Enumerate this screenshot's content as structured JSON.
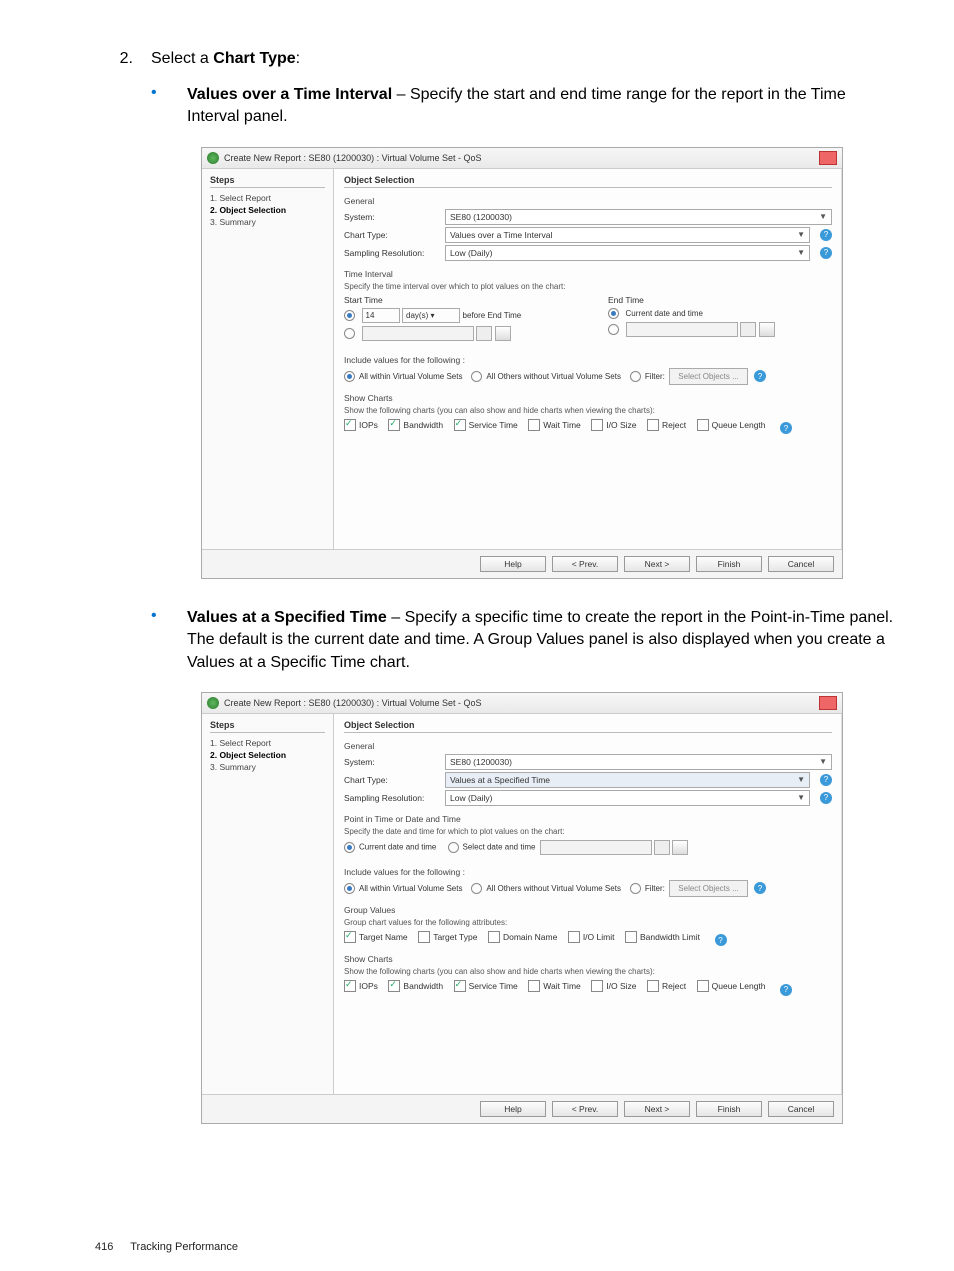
{
  "step": {
    "num": "2.",
    "label_prefix": "Select a ",
    "label_bold": "Chart Type",
    "label_suffix": ":"
  },
  "bullets": [
    {
      "title": "Values over a Time Interval",
      "desc": " – Specify the start and end time range for the report in the Time Interval panel."
    },
    {
      "title": "Values at a Specified Time",
      "desc": " – Specify a specific time to create the report in the Point-in-Time panel. The default is the current date and time. A Group Values panel is also displayed when you create a Values at a Specific Time chart."
    }
  ],
  "dialog_common": {
    "title": "Create New Report : SE80 (1200030) : Virtual Volume Set - QoS",
    "steps_header": "Steps",
    "step1": "1. Select Report",
    "step2": "2. Object Selection",
    "step3": "3. Summary",
    "panel_header": "Object Selection",
    "section_general": "General",
    "label_system": "System:",
    "field_system": "SE80 (1200030)",
    "label_chart_type": "Chart Type:",
    "label_sampling": "Sampling Resolution:",
    "field_sampling": "Low (Daily)",
    "include_header": "Include values for the following :",
    "radio_all_within": "All within Virtual Volume Sets",
    "radio_all_others": "All Others without Virtual Volume Sets",
    "radio_filter": "Filter:",
    "btn_select_objects": "Select Objects ...",
    "show_charts_header": "Show Charts",
    "show_charts_text": "Show the following charts (you can also show and hide charts when viewing the charts):",
    "chk_iops": "IOPs",
    "chk_bandwidth": "Bandwidth",
    "chk_service": "Service Time",
    "chk_wait": "Wait Time",
    "chk_iosize": "I/O Size",
    "chk_reject": "Reject",
    "chk_queue": "Queue Length",
    "btn_help": "Help",
    "btn_prev": "< Prev.",
    "btn_next": "Next >",
    "btn_finish": "Finish",
    "btn_cancel": "Cancel"
  },
  "dialog1": {
    "field_chart_type": "Values over a Time Interval",
    "ti_header": "Time Interval",
    "ti_text": "Specify the time interval over which to plot values on the chart:",
    "start_time": "Start Time",
    "end_time": "End Time",
    "val_num": "14",
    "val_unit": "day(s)",
    "before_end": "before End Time",
    "current_dt": "Current date and time"
  },
  "dialog2": {
    "field_chart_type": "Values at a Specified Time",
    "pit_header": "Point in Time or Date and Time",
    "pit_text": "Specify the date and time for which to plot values on the chart:",
    "radio_current": "Current date and time",
    "radio_select": "Select date and time",
    "group_header": "Group Values",
    "group_text": "Group chart values for the following attributes:",
    "chk_target_name": "Target Name",
    "chk_target_type": "Target Type",
    "chk_domain": "Domain Name",
    "chk_io_limit": "I/O Limit",
    "chk_bw_limit": "Bandwidth Limit"
  },
  "footer": {
    "page": "416",
    "section": "Tracking Performance"
  }
}
